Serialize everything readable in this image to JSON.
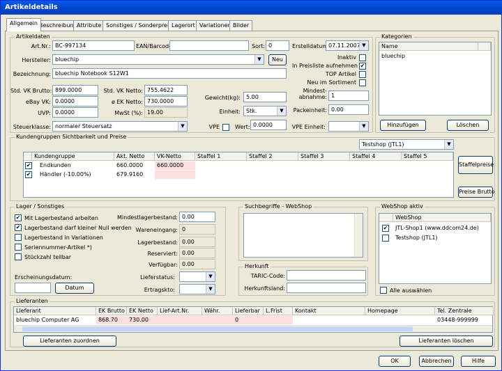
{
  "window": {
    "title": "Artikeldetails"
  },
  "tabs": [
    "Allgemein",
    "Beschreibung",
    "Attribute",
    "Sonstiges / Sonderpreise",
    "Lagerort",
    "Variationen",
    "Bilder"
  ],
  "artikeldaten": {
    "legend": "Artikeldaten",
    "artnr_label": "Art.Nr.:",
    "artnr": "BC-997134",
    "ean_label": "EAN/Barcode:",
    "ean": "",
    "sort_label": "Sort:",
    "sort": "0",
    "erstelldatum_label": "Erstelldatum:",
    "erstelldatum": "07.11.2007",
    "hersteller_label": "Hersteller:",
    "hersteller": "bluechip",
    "neu_button": "Neu",
    "bezeichnung_label": "Bezeichnung:",
    "bezeichnung": "bluechip Notebook S12W1",
    "inaktiv_label": "Inaktiv",
    "preisliste_label": "In Preisliste aufnehmen",
    "top_label": "TOP Artikel",
    "neu_sortiment_label": "Neu im Sortiment",
    "std_vk_brutto_label": "Std. VK Brutto:",
    "std_vk_brutto": "899.0000",
    "std_vk_netto_label": "Std. VK Netto:",
    "std_vk_netto": "755.4622",
    "ebay_vk_label": "eBay VK:",
    "ebay_vk": "0.0000",
    "ek_netto_label": "ø EK Netto:",
    "ek_netto": "730.0000",
    "uvp_label": "UVP:",
    "uvp": "0.0000",
    "mwst_label": "MwSt (%):",
    "mwst": "19.00",
    "gewicht_label": "Gewicht(kg):",
    "gewicht": "5.00",
    "mindestabnahme_label": "Mindest-\nabnahme:",
    "mindestabnahme": "1",
    "einheit_label": "Einheit:",
    "einheit": "Stk.",
    "packeinheit_label": "Packeinheit:",
    "packeinheit": "0.00",
    "steuerklasse_label": "Steuerklasse:",
    "steuerklasse": "normaler Steuersatz",
    "vpe_label": "VPE",
    "wert_label": "Wert:",
    "wert": "0.0000",
    "vpe_einheit_label": "VPE Einheit:",
    "vpe_einheit": ""
  },
  "kategorien": {
    "legend": "Kategorien",
    "col": "Name",
    "items": [
      "bluechip"
    ],
    "add_button": "Hinzufügen",
    "delete_button": "Löschen"
  },
  "kundengruppen": {
    "legend": "Kundengruppen Sichtbarkeit und Preise",
    "shop": "Testshop (JTL1)",
    "columns": [
      "Kundengruppe",
      "Akt. Netto",
      "VK-Netto",
      "Staffel 1",
      "Staffel 2",
      "Staffel 3",
      "Staffel 4",
      "Staffel 5"
    ],
    "rows": [
      [
        "Endkunden",
        "660.0000",
        "660.0000"
      ],
      [
        "Händler (-10.00%)",
        "679.9160",
        ""
      ]
    ],
    "staffelpreise_button": "Staffelpreise",
    "preise_brutto_button": "Preise Brutto"
  },
  "lager": {
    "legend": "Lager / Sonstiges",
    "checks": [
      {
        "label": "Mit Lagerbestand arbeiten",
        "checked": true
      },
      {
        "label": "Lagerbestand darf kleiner Null werden",
        "checked": true
      },
      {
        "label": "Lagerbestand in Variationen",
        "checked": false
      },
      {
        "label": "Seriennummer-Artikel *)",
        "checked": false
      },
      {
        "label": "Stückzahl teilbar",
        "checked": false
      }
    ],
    "erscheinungsdatum_label": "Erscheinungsdatum:",
    "datum_button": "Datum",
    "mindestlager_label": "Mindestlagerbestand:",
    "mindestlager": "0.00",
    "wareneingang_label": "Wareneingang:",
    "wareneingang": "0",
    "lagerbestand_label": "Lagerbestand:",
    "lagerbestand": "0.00",
    "reserviert_label": "Reserviert:",
    "reserviert": "0.00",
    "verfuegbar_label": "Verfügbar:",
    "verfuegbar": "0.00",
    "lieferstatus_label": "Lieferstatus:",
    "ertragskto_label": "Ertragskto:"
  },
  "suchbegriffe": {
    "legend": "Suchbegriffe - WebShop"
  },
  "herkunft": {
    "legend": "Herkunft",
    "taric_label": "TARIC-Code:",
    "land_label": "Herkunftsland:"
  },
  "webshop": {
    "legend": "WebShop aktiv",
    "col": "WebShop",
    "items": [
      {
        "label": "JTL-Shop1 (www.ddcom24.de)",
        "checked": true
      },
      {
        "label": "Testshop (JTL1)",
        "checked": false
      }
    ],
    "alle_label": "Alle auswählen"
  },
  "lieferanten": {
    "legend": "Lieferanten",
    "columns": [
      "Lieferant",
      "EK Brutto",
      "EK Netto",
      "Lief-Art.Nr.",
      "Währ.",
      "Lieferbar",
      "L.Frist",
      "Kontakt",
      "Homepage",
      "Tel. Zentrale"
    ],
    "rows": [
      [
        "bluechip Computer AG",
        "868.70",
        "730.00",
        "",
        "",
        "0",
        "",
        "",
        "",
        "03448-999999"
      ]
    ],
    "zuordnen_button": "Lieferanten zuordnen",
    "loeschen_button": "Lieferanten löschen"
  },
  "footer": {
    "ok": "OK",
    "abbrechen": "Abbrechen",
    "hilfe": "Hilfe"
  },
  "colors": {
    "titlebar": "#0042c9",
    "dialog": "#ece9d8",
    "highlight": "#fde0dd"
  }
}
